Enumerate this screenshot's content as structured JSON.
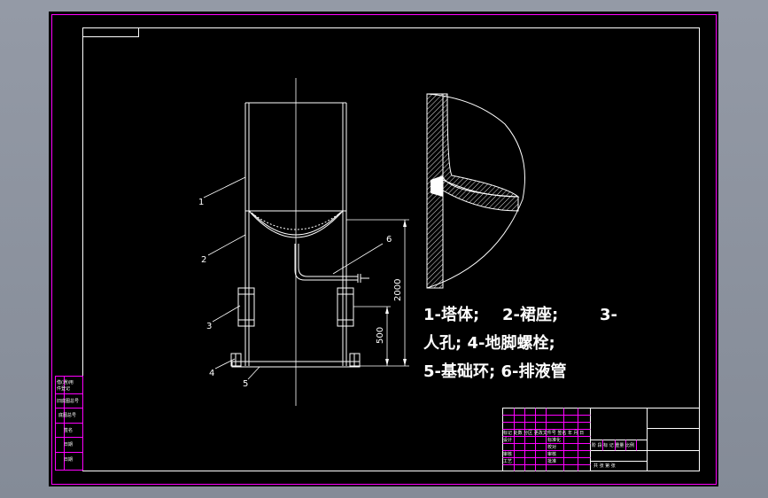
{
  "colors": {
    "background": "#000000",
    "frame": "#ff00ff",
    "lines": "#ffffff",
    "viewport": "#8c94a0"
  },
  "callouts": {
    "c1": "1",
    "c2": "2",
    "c3": "3",
    "c4": "4",
    "c5": "5",
    "c6": "6"
  },
  "dimensions": {
    "height_total": "2000",
    "height_manhole": "500"
  },
  "legend": {
    "line1a": "1-塔体;",
    "line1b": "2-裙座;",
    "line1c": "3-",
    "line2": "人孔;  4-地脚螺栓;",
    "line3": "5-基础环; 6-排液管"
  },
  "left_block": {
    "r1": "借(通)用",
    "r1b": "件登记",
    "r2": "旧底图总号",
    "r3": "底图总号",
    "r4": "签名",
    "r5": "日期",
    "r6": "日期"
  },
  "title_block": {
    "t1": "标记 处数 分区 更改文件号 签名 年 月 日",
    "t2": "设计",
    "t3": "标准化",
    "t4": "审核",
    "t5": "工艺",
    "t6": "批准",
    "t7": "阶 段 标 记  重量 比例",
    "t8": "共 张 第 张",
    "t9": "校对"
  }
}
